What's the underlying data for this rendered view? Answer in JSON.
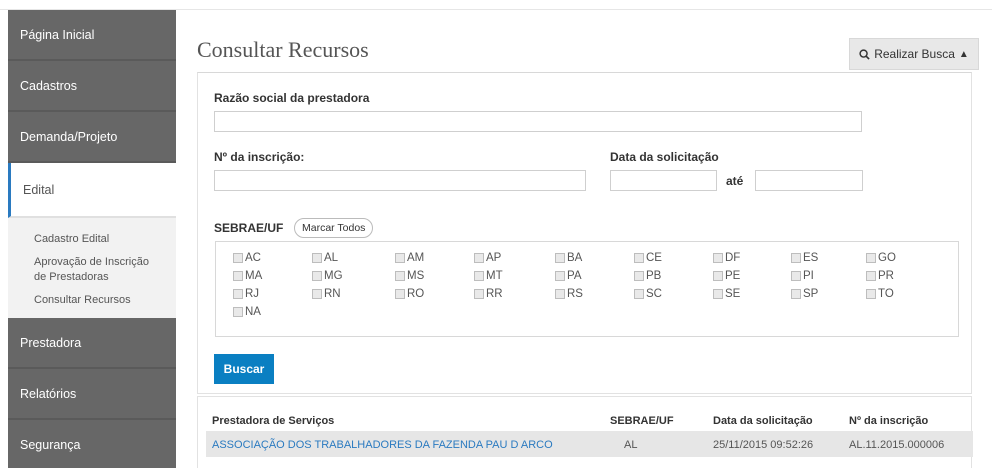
{
  "sidebar": {
    "items": [
      {
        "label": "Página Inicial"
      },
      {
        "label": "Cadastros"
      },
      {
        "label": "Demanda/Projeto"
      },
      {
        "label": "Edital"
      },
      {
        "label": "Prestadora"
      },
      {
        "label": "Relatórios"
      },
      {
        "label": "Segurança"
      }
    ],
    "sub_items": [
      {
        "label": "Cadastro Edital"
      },
      {
        "label": "Aprovação de Inscrição de Prestadoras"
      },
      {
        "label": "Consultar Recursos"
      }
    ]
  },
  "main": {
    "title": "Consultar Recursos",
    "search_toggle": {
      "label": "Realizar Busca",
      "icon": "search-icon",
      "arrow": "▲"
    },
    "filters": {
      "razao_label": "Razão social da prestadora",
      "razao_value": "",
      "inscricao_label": "Nº da inscrição:",
      "inscricao_value": "",
      "data_label": "Data da solicitação",
      "data_from": "",
      "ate_label": "até",
      "data_to": "",
      "uf_label": "SEBRAE/UF",
      "marcar_todos": "Marcar Todos",
      "ufs": [
        "AC",
        "AL",
        "AM",
        "AP",
        "BA",
        "CE",
        "DF",
        "ES",
        "GO",
        "MA",
        "MG",
        "MS",
        "MT",
        "PA",
        "PB",
        "PE",
        "PI",
        "PR",
        "RJ",
        "RN",
        "RO",
        "RR",
        "RS",
        "SC",
        "SE",
        "SP",
        "TO",
        "NA"
      ],
      "buscar": "Buscar"
    },
    "results": {
      "headers": [
        "Prestadora de Serviços",
        "SEBRAE/UF",
        "Data da solicitação",
        "Nº da inscrição"
      ],
      "rows": [
        [
          "ASSOCIAÇÃO DOS TRABALHADORES DA FAZENDA PAU D ARCO",
          "AL",
          "25/11/2015 09:52:26",
          "AL.11.2015.000006"
        ]
      ]
    }
  },
  "colors": {
    "sidebar": "#676767",
    "accent": "#0a7fc2",
    "link": "#2a7ac0"
  }
}
